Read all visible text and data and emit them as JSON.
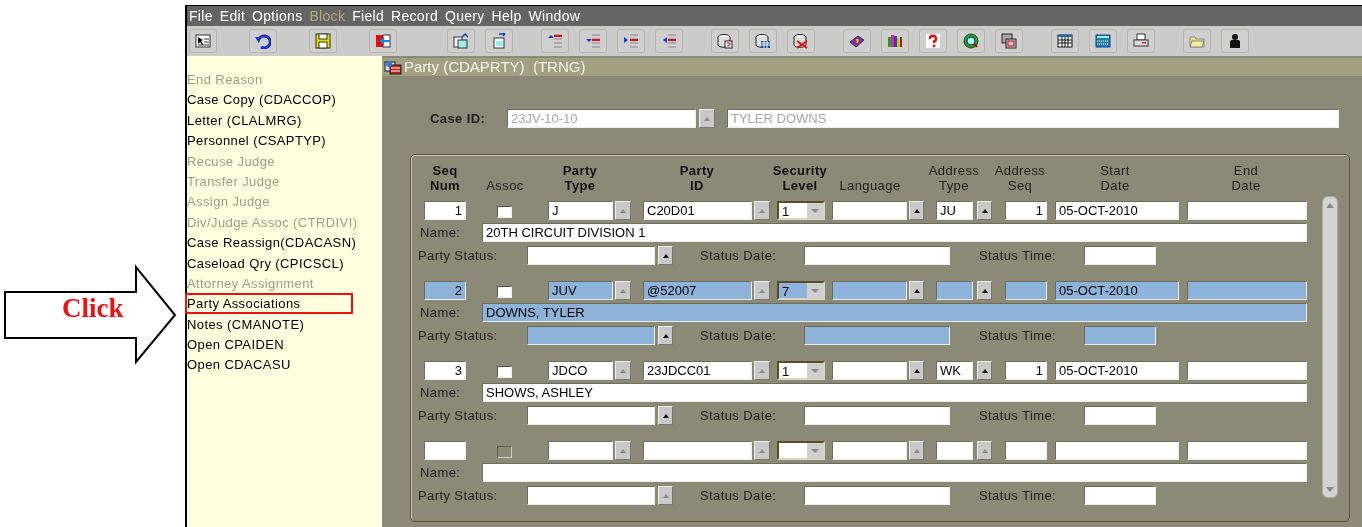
{
  "annotation": {
    "label": "Click"
  },
  "menu": [
    {
      "label": "File",
      "disabled": false
    },
    {
      "label": "Edit",
      "disabled": false
    },
    {
      "label": "Options",
      "disabled": false
    },
    {
      "label": "Block",
      "disabled": true
    },
    {
      "label": "Field",
      "disabled": false
    },
    {
      "label": "Record",
      "disabled": false
    },
    {
      "label": "Query",
      "disabled": false
    },
    {
      "label": "Help",
      "disabled": false
    },
    {
      "label": "Window",
      "disabled": false
    }
  ],
  "sidebar": {
    "items": [
      {
        "label": "End Reason",
        "disabled": true,
        "highlighted": false
      },
      {
        "label": "Case Copy (CDACCOP)",
        "disabled": false,
        "highlighted": false
      },
      {
        "label": "Letter (CLALMRG)",
        "disabled": false,
        "highlighted": false
      },
      {
        "label": "Personnel (CSAPTYP)",
        "disabled": false,
        "highlighted": false
      },
      {
        "label": "Recuse Judge",
        "disabled": true,
        "highlighted": false
      },
      {
        "label": "Transfer Judge",
        "disabled": true,
        "highlighted": false
      },
      {
        "label": "Assign Judge",
        "disabled": true,
        "highlighted": false
      },
      {
        "label": "Div/Judge Assoc (CTRDIVI)",
        "disabled": true,
        "highlighted": false
      },
      {
        "label": "Case Reassign(CDACASN)",
        "disabled": false,
        "highlighted": false
      },
      {
        "label": "Caseload Qry (CPICSCL)",
        "disabled": false,
        "highlighted": false
      },
      {
        "label": "Attorney Assignment",
        "disabled": true,
        "highlighted": false
      },
      {
        "label": "Party Associations",
        "disabled": false,
        "highlighted": true
      },
      {
        "label": "Notes (CMANOTE)",
        "disabled": false,
        "highlighted": false
      },
      {
        "label": "Open CPAIDEN",
        "disabled": false,
        "highlighted": false
      },
      {
        "label": "Open CDACASU",
        "disabled": false,
        "highlighted": false
      }
    ]
  },
  "window": {
    "title": "Party (CDAPRTY)  (TRNG)"
  },
  "case": {
    "label": "Case ID:",
    "case_id": "23JV-10-10",
    "party_name": "TYLER DOWNS"
  },
  "table": {
    "columns": [
      {
        "lines": [
          "Seq",
          "Num"
        ],
        "bold": true
      },
      {
        "lines": [
          "Assoc"
        ],
        "bold": false
      },
      {
        "lines": [
          "Party",
          "Type"
        ],
        "bold": true
      },
      {
        "lines": [
          "Party",
          "ID"
        ],
        "bold": true
      },
      {
        "lines": [
          "Security",
          "Level"
        ],
        "bold": true
      },
      {
        "lines": [
          "Language"
        ],
        "bold": false
      },
      {
        "lines": [
          "Address",
          "Type"
        ],
        "bold": false
      },
      {
        "lines": [
          "Address",
          "Seq"
        ],
        "bold": false
      },
      {
        "lines": [
          "Start",
          "Date"
        ],
        "bold": false
      },
      {
        "lines": [
          "End",
          "Date"
        ],
        "bold": false
      }
    ],
    "records": [
      {
        "selected": false,
        "seq": "1",
        "assoc": {
          "checked": false,
          "disabled": false
        },
        "party_type": "J",
        "party_id": "C20D01",
        "security_level": "1",
        "address_type": "JU",
        "address_seq": "1",
        "start_date": "05-OCT-2010",
        "name_label": "Name:",
        "name": "20TH CIRCUIT DIVISION 1",
        "status_label": "Party Status:",
        "status_date_label": "Status Date:",
        "status_time_label": "Status Time:"
      },
      {
        "selected": true,
        "seq": "2",
        "assoc": {
          "checked": false,
          "disabled": false
        },
        "party_type": "JUV",
        "party_id": "@52007",
        "security_level": "7",
        "start_date": "05-OCT-2010",
        "name_label": "Name:",
        "name": "DOWNS, TYLER",
        "status_label": "Party Status:",
        "status_date_label": "Status Date:",
        "status_time_label": "Status Time:"
      },
      {
        "selected": false,
        "seq": "3",
        "assoc": {
          "checked": false,
          "disabled": false
        },
        "party_type": "JDCO",
        "party_id": "23JDCC01",
        "security_level": "1",
        "address_type": "WK",
        "address_seq": "1",
        "start_date": "05-OCT-2010",
        "name_label": "Name:",
        "name": "SHOWS, ASHLEY",
        "status_label": "Party Status:",
        "status_date_label": "Status Date:",
        "status_time_label": "Status Time:"
      },
      {
        "selected": false,
        "assoc": {
          "checked": false,
          "disabled": true
        },
        "name_label": "Name:",
        "status_label": "Party Status:",
        "status_date_label": "Status Date:",
        "status_time_label": "Status Time:"
      }
    ]
  }
}
